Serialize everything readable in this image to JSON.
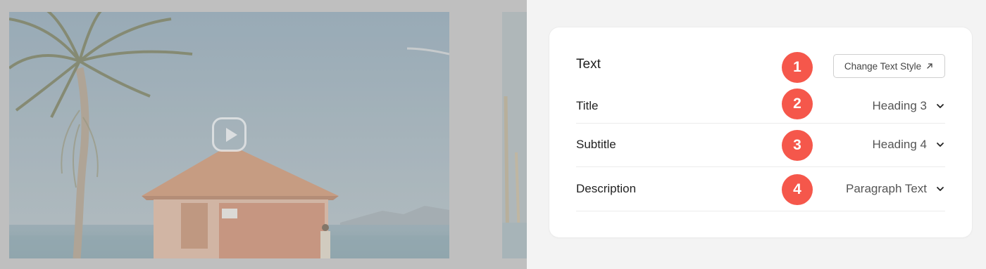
{
  "preview": {
    "play_icon": "play-icon"
  },
  "panel": {
    "section_label": "Text",
    "change_style_button": "Change Text Style",
    "change_style_icon": "external-arrow-icon",
    "rows": [
      {
        "label": "Title",
        "value": "Heading 3"
      },
      {
        "label": "Subtitle",
        "value": "Heading 4"
      },
      {
        "label": "Description",
        "value": "Paragraph Text"
      }
    ],
    "dropdown_icon": "chevron-down-icon"
  },
  "badges": [
    "1",
    "2",
    "3",
    "4"
  ],
  "colors": {
    "badge": "#f5574b",
    "panel_bg": "#ffffff",
    "page_bg": "#f3f3f3",
    "preview_bg": "#bfbfbf"
  }
}
